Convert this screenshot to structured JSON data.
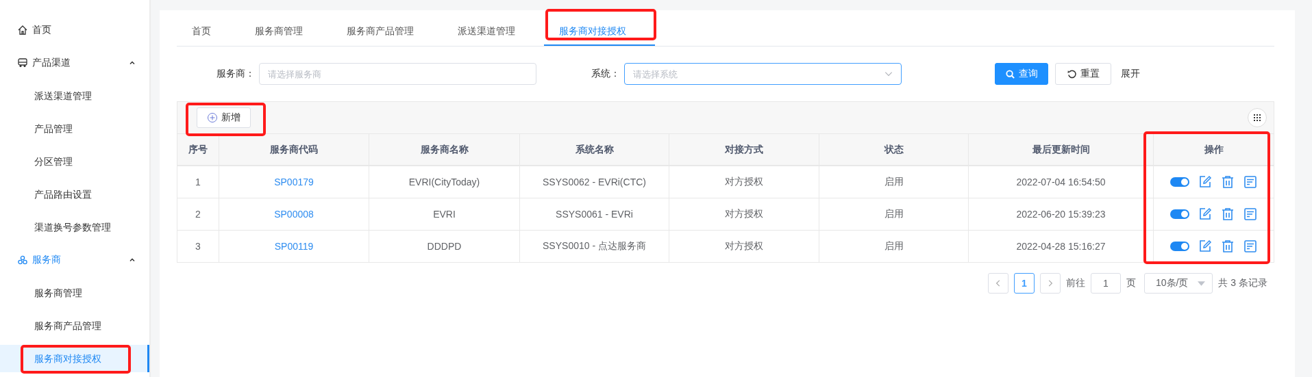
{
  "sidebar": {
    "items": [
      {
        "kind": "link",
        "label": "首页",
        "selected": false
      },
      {
        "kind": "group",
        "label": "产品渠道",
        "expanded": true,
        "children": [
          {
            "label": "派送渠道管理",
            "selected": false,
            "marked": false
          },
          {
            "label": "产品管理",
            "selected": false,
            "marked": false
          },
          {
            "label": "分区管理",
            "selected": false,
            "marked": false
          },
          {
            "label": "产品路由设置",
            "selected": false,
            "marked": false
          },
          {
            "label": "渠道换号参数管理",
            "selected": false,
            "marked": false
          }
        ]
      },
      {
        "kind": "group",
        "label": "服务商",
        "expanded": true,
        "children": [
          {
            "label": "服务商管理",
            "selected": false,
            "marked": false
          },
          {
            "label": "服务商产品管理",
            "selected": false,
            "marked": false
          },
          {
            "label": "服务商对接授权",
            "selected": true,
            "marked": true
          }
        ]
      }
    ]
  },
  "tabs": [
    {
      "label": "首页",
      "selected": false,
      "marked": false
    },
    {
      "label": "服务商管理",
      "selected": false,
      "marked": false
    },
    {
      "label": "服务商产品管理",
      "selected": false,
      "marked": false
    },
    {
      "label": "派送渠道管理",
      "selected": false,
      "marked": false
    },
    {
      "label": "服务商对接授权",
      "selected": true,
      "marked": true
    }
  ],
  "filters": [
    {
      "kind": "input",
      "label": "服务商：",
      "placeholder": "请选择服务商",
      "focused": false
    },
    {
      "kind": "select",
      "label": "系统：",
      "placeholder": "请选择系统",
      "focused": true
    }
  ],
  "filter_buttons": [
    {
      "kind": "primary",
      "label": "查询"
    },
    {
      "kind": "default",
      "label": "重置"
    }
  ],
  "expand_link": "展开",
  "toolbar": {
    "add_button": {
      "label": "新增",
      "marked": true
    }
  },
  "table": {
    "columns": [
      {
        "label": "序号",
        "marked": false
      },
      {
        "label": "服务商代码",
        "marked": false
      },
      {
        "label": "服务商名称",
        "marked": false
      },
      {
        "label": "系统名称",
        "marked": false
      },
      {
        "label": "对接方式",
        "marked": false
      },
      {
        "label": "状态",
        "marked": false
      },
      {
        "label": "最后更新时间",
        "marked": false
      },
      {
        "label": "操作",
        "marked": true
      }
    ],
    "rows": [
      {
        "cells": [
          "1",
          "SP00179",
          "EVRI(CityToday)",
          "SSYS0062 - EVRi(CTC)",
          "对方授权",
          "启用",
          "2022-07-04 16:54:50"
        ],
        "enabled": true
      },
      {
        "cells": [
          "2",
          "SP00008",
          "EVRI",
          "SSYS0061 - EVRi",
          "对方授权",
          "启用",
          "2022-06-20 15:39:23"
        ],
        "enabled": true
      },
      {
        "cells": [
          "3",
          "SP00119",
          "DDDPD",
          "SSYS0010 - 点达服务商",
          "对方授权",
          "启用",
          "2022-04-28 15:16:27"
        ],
        "enabled": true
      }
    ]
  },
  "pagination": {
    "pages": [
      {
        "label": "1",
        "selected": true
      }
    ],
    "goto_label": "前往",
    "goto_value": "1",
    "page_unit": "页",
    "page_size": "10条/页",
    "total": "共 3 条记录"
  }
}
